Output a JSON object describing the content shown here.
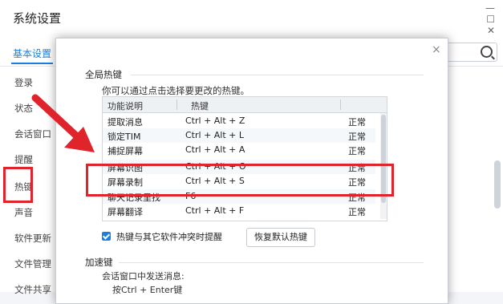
{
  "window": {
    "title": "系统设置",
    "controls": [
      "—",
      "☐",
      "✕"
    ],
    "tab": "基本设置",
    "search_placeholder": ""
  },
  "sidebar": {
    "items": [
      {
        "label": "登录"
      },
      {
        "label": "状态"
      },
      {
        "label": "会话窗口"
      },
      {
        "label": "提醒"
      },
      {
        "label": "热键"
      },
      {
        "label": "声音"
      },
      {
        "label": "软件更新"
      },
      {
        "label": "文件管理"
      },
      {
        "label": "文件共享"
      }
    ]
  },
  "dialog": {
    "close": "×",
    "section_hotkeys": "全局热键",
    "hint": "你可以通过点击选择要更改的热键。",
    "table": {
      "headers": [
        "功能说明",
        "热键"
      ],
      "rows": [
        {
          "name": "提取消息",
          "key": "Ctrl + Alt + Z",
          "status": "正常"
        },
        {
          "name": "锁定TIM",
          "key": "Ctrl + Alt + L",
          "status": "正常"
        },
        {
          "name": "捕捉屏幕",
          "key": "Ctrl + Alt + A",
          "status": "正常"
        },
        {
          "name": "屏幕识图",
          "key": "Ctrl + Alt + O",
          "status": "正常"
        },
        {
          "name": "屏幕录制",
          "key": "Ctrl + Alt + S",
          "status": "正常"
        },
        {
          "name": "聊天记录里找",
          "key": "F6",
          "status": "正常"
        },
        {
          "name": "屏幕翻译",
          "key": "Ctrl + Alt + F",
          "status": "正常"
        }
      ]
    },
    "conflict_checkbox": {
      "label": "热键与其它软件冲突时提醒",
      "checked": true
    },
    "restore_button": "恢复默认热键",
    "section_speed": "加速键",
    "speed_hint": "会话窗口中发送消息:",
    "speed_option": "按Ctrl + Enter键"
  },
  "colors": {
    "accent": "#1a7fe0",
    "annotation": "#e0242b"
  }
}
